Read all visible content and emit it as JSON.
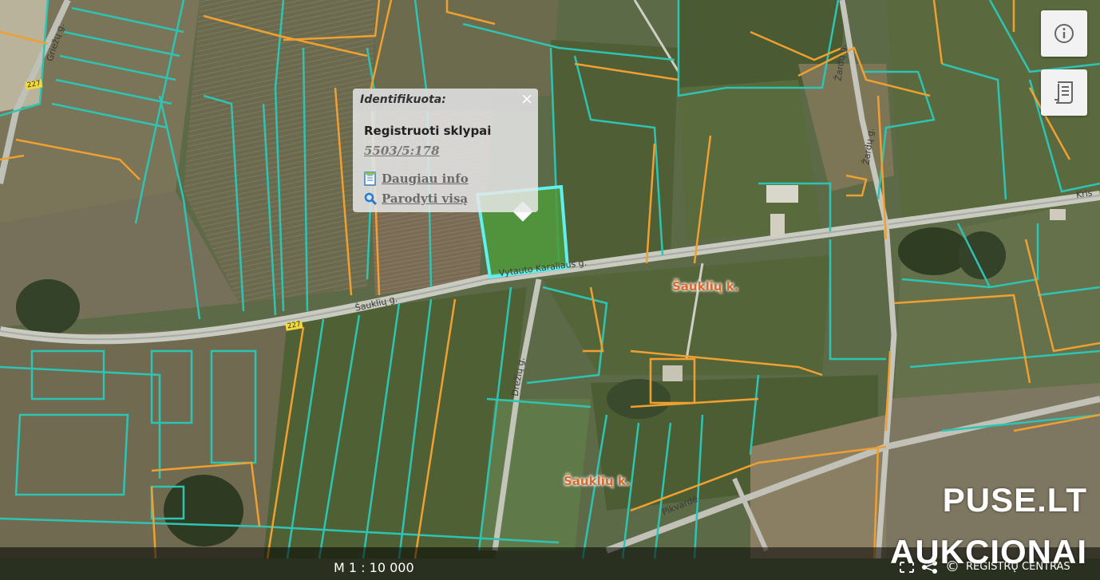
{
  "map": {
    "locality_labels": [
      "Šauklių k.",
      "Šauklių k."
    ],
    "road_labels": {
      "vytautas": "Vytauto Karaliaus g.",
      "sauklu": "Šauklių g.",
      "griezu": "Griežų g.",
      "zardu_upper": "Žardų g.",
      "zardu_lower": "Žardų g.",
      "dreziu": "Drežių g.",
      "kris": "Kris",
      "pajuodze": "Pikvardė",
      "route_227_a": "227",
      "route_227_b": "227"
    },
    "colors": {
      "cadastral_outline": "#2ec4b4",
      "registered_outline": "#f0a030",
      "selected_parcel": "#5ff0f0",
      "locality_text": "#d8692a"
    }
  },
  "controls": {
    "info_icon": "info-icon",
    "legend_icon": "document-icon"
  },
  "popup": {
    "title": "Identifikuota:",
    "close": "×",
    "heading": "Registruoti sklypai",
    "parcel_id": "5503/5:178",
    "more_info": "Daugiau info",
    "show_all": "Parodyti visą"
  },
  "footer": {
    "scale": "M 1 : 10 000",
    "credits": "REGISTRŲ CENTRAS",
    "copyright": "©"
  },
  "watermark": {
    "line1": "PUSE.LT",
    "line2": "AUKCIONAI"
  }
}
